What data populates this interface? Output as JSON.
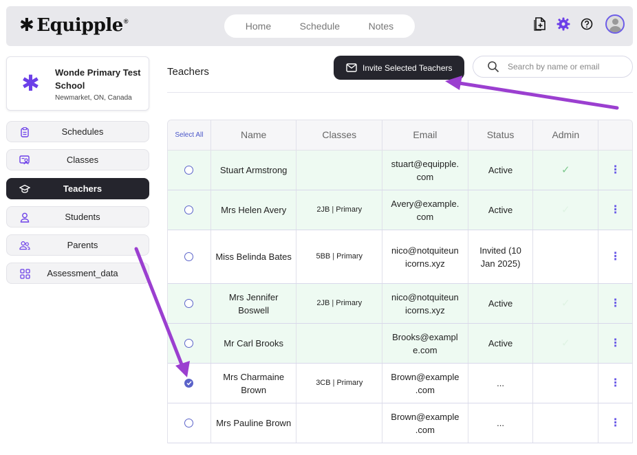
{
  "app": {
    "logo_text": "Equipple",
    "logo_mark": "®",
    "nav": [
      "Home",
      "Schedule",
      "Notes"
    ]
  },
  "school": {
    "name": "Wonde Primary Test School",
    "location": "Newmarket, ON, Canada"
  },
  "sidebar": {
    "items": [
      {
        "label": "Schedules",
        "icon": "clipboard-icon"
      },
      {
        "label": "Classes",
        "icon": "class-board-icon"
      },
      {
        "label": "Teachers",
        "icon": "graduation-cap-icon",
        "active": true
      },
      {
        "label": "Students",
        "icon": "person-icon"
      },
      {
        "label": "Parents",
        "icon": "people-icon"
      },
      {
        "label": "Assessment_data",
        "icon": "grid-icon"
      }
    ]
  },
  "page": {
    "title": "Teachers",
    "invite_label": "Invite Selected Teachers",
    "search_placeholder": "Search by name or email"
  },
  "table": {
    "headers": [
      "Select All",
      "Name",
      "Classes",
      "Email",
      "Status",
      "Admin",
      ""
    ],
    "rows": [
      {
        "name": "Stuart Armstrong",
        "class_code": "",
        "class_type": "",
        "email": "stuart@equipple.com",
        "email_l1": "stuart@equipple.",
        "email_l2": "com",
        "status": "Active",
        "admin": true,
        "checked": false
      },
      {
        "name": "Mrs Helen Avery",
        "class_code": "2JB",
        "class_type": "Primary",
        "email": "Avery@example.com",
        "email_l1": "Avery@example.",
        "email_l2": "com",
        "status": "Active",
        "admin": false,
        "checked": false
      },
      {
        "name": "Miss Belinda Bates",
        "class_code": "5BB",
        "class_type": "Primary",
        "email": "nico@notquiteunicorns.xyz",
        "email_l1": "nico@notquiteun",
        "email_l2": "icorns.xyz",
        "status": "Invited (10 Jan 2025)",
        "admin": false,
        "checked": false
      },
      {
        "name": "Mrs Jennifer Boswell",
        "class_code": "2JB",
        "class_type": "Primary",
        "email": "nico@notquiteunicorns.xyz",
        "email_l1": "nico@notquiteun",
        "email_l2": "icorns.xyz",
        "status": "Active",
        "admin": false,
        "checked": false
      },
      {
        "name": "Mr Carl Brooks",
        "class_code": "",
        "class_type": "",
        "email": "Brooks@example.com",
        "email_l1": "Brooks@exampl",
        "email_l2": "e.com",
        "status": "Active",
        "admin": false,
        "checked": false
      },
      {
        "name": "Mrs Charmaine Brown",
        "class_code": "3CB",
        "class_type": "Primary",
        "email": "Brown@example.com",
        "email_l1": "Brown@example",
        "email_l2": ".com",
        "status": "...",
        "admin": false,
        "checked": true
      },
      {
        "name": "Mrs Pauline Brown",
        "class_code": "",
        "class_type": "",
        "email": "Brown@example.com",
        "email_l1": "Brown@example",
        "email_l2": ".com",
        "status": "...",
        "admin": false,
        "checked": false
      }
    ]
  },
  "colors": {
    "accent": "#6c3fe8",
    "dark": "#25252d",
    "active_row": "#eefaf2",
    "annotation_arrow": "#9b3fd0"
  }
}
